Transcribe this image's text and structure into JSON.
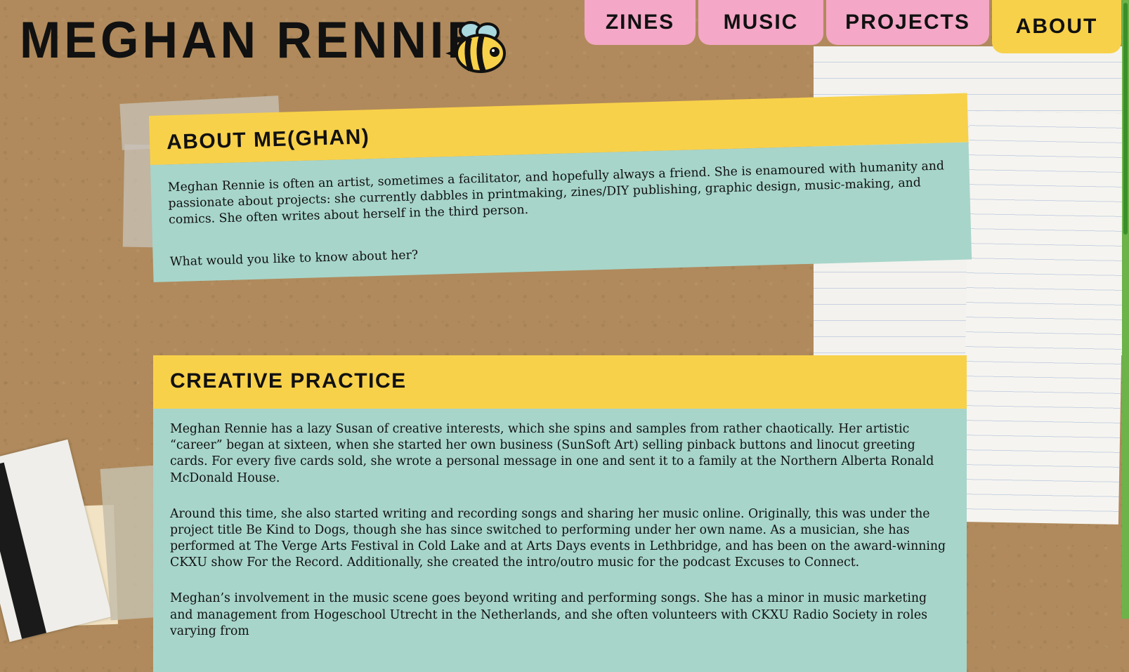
{
  "site": {
    "title": "MEGHAN RENNIE"
  },
  "nav": {
    "tabs": [
      {
        "label": "ZINES",
        "active": false
      },
      {
        "label": "MUSIC",
        "active": false
      },
      {
        "label": "PROJECTS",
        "active": false
      },
      {
        "label": "ABOUT",
        "active": true
      }
    ]
  },
  "colors": {
    "nav_pink": "#f4a7c6",
    "accent_yellow": "#f8d14a",
    "card_teal": "#a7d5ca",
    "scrollbar_green": "#6cb349"
  },
  "about": {
    "heading": "ABOUT ME(GHAN)",
    "paragraphs": [
      "Meghan Rennie is often an artist, sometimes a facilitator, and hopefully always a friend. She is enamoured with humanity and passionate about projects: she currently dabbles in printmaking, zines/DIY publishing, graphic design, music-making, and comics. She often writes about herself in the third person.",
      "What would you like to know about her?"
    ]
  },
  "creative": {
    "heading": "CREATIVE PRACTICE",
    "paragraphs": [
      "Meghan Rennie has a lazy Susan of creative interests, which she spins and samples from rather chaotically. Her artistic “career” began at sixteen, when she started her own business (SunSoft Art) selling pinback buttons and linocut greeting cards. For every five cards sold, she wrote a personal message in one and sent it to a family at the Northern Alberta Ronald McDonald House.",
      "Around this time, she also started writing and recording songs and sharing her music online. Originally, this was under the project title Be Kind to Dogs, though she has since switched to performing under her own name. As a musician, she has performed at The Verge Arts Festival in Cold Lake and at Arts Days events in Lethbridge, and has been on the award-winning CKXU show For the Record. Additionally, she created the intro/outro music for the podcast Excuses to Connect.",
      "Meghan’s involvement in the music scene goes beyond writing and performing songs. She has a minor in music marketing and management from Hogeschool Utrecht in the Netherlands, and she often volunteers with CKXU Radio Society in roles varying from"
    ]
  },
  "icons": {
    "logo": "bee-icon"
  }
}
